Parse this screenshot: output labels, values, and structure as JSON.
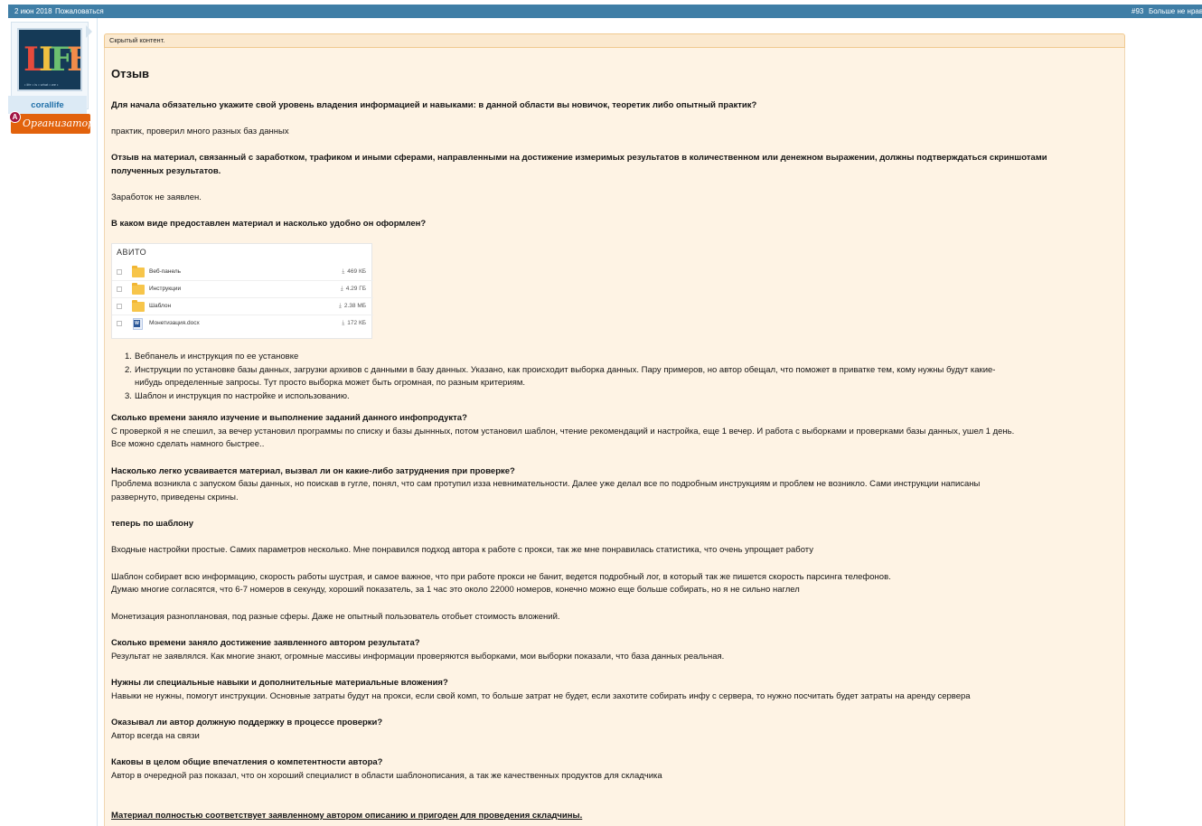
{
  "topbar": {
    "date": "2 июн 2018",
    "report": "Пожаловаться",
    "post_number": "#93",
    "dislike": "Больше не нравится"
  },
  "user": {
    "name": "corallife",
    "badge_letter": "A",
    "badge_label": "Организатор",
    "avatar_text": "LIFE",
    "avatar_tagline": "• life • is • what • we •"
  },
  "hidden_content_label": "Скрытый контент.",
  "review": {
    "heading": "Отзыв",
    "q1": "Для начала обязательно укажите свой уровень владения информацией и навыками: в данной области вы новичок, теоретик либо опытный практик?",
    "a1": "практик, проверил много разных баз данных",
    "q2_line1": "Отзыв на материал, связанный с заработком, трафиком и иными сферами, направленными на достижение измеримых результатов в количественном или денежном выражении, должны подтверждаться скриншотами",
    "q2_line2": "полученных результатов.",
    "a2": "Заработок не заявлен.",
    "q3": "В каком виде предоставлен материал и насколько удобно он оформлен?",
    "files_title": "АВИТО",
    "files": [
      {
        "name": "Веб-панель",
        "size": "469 КБ",
        "icon": "folder-icon"
      },
      {
        "name": "Инструкции",
        "size": "4.29 ГБ",
        "icon": "folder-icon"
      },
      {
        "name": "Шаблон",
        "size": "2.38 МБ",
        "icon": "folder-icon"
      },
      {
        "name": "Монетизация.docx",
        "size": "172 КБ",
        "icon": "word-document-icon"
      }
    ],
    "download_glyph": "⤓",
    "list": [
      {
        "n": "1.",
        "lines": [
          "Вебпанель и инструкция по ее установке"
        ]
      },
      {
        "n": "2.",
        "lines": [
          "Инструкции по установке базы данных, загрузки архивов с данными в базу данных. Указано, как происходит выборка данных. Пару примеров, но автор обещал, что поможет в приватке тем, кому нужны будут какие-",
          "нибудь определенные запросы. Тут просто выборка может быть огромная, по разным критериям."
        ]
      },
      {
        "n": "3.",
        "lines": [
          "Шаблон и инструкция по настройке и использованию."
        ]
      }
    ],
    "q4": "Сколько времени заняло изучение и выполнение заданий данного инфопродукта?",
    "a4_line1": "С проверкой я не спешил, за вечер установил программы по списку и базы дыннных, потом установил шаблон, чтение рекомендаций и настройка, еще 1 вечер. И работа с выборками и проверками базы данных, ушел 1 день.",
    "a4_line2": "Все можно сделать намного быстрее..",
    "q5": "Насколько легко усваивается материал, вызвал ли он какие-либо затруднения при проверке?",
    "a5_line1": "Проблема возникла с запуском базы данных, но поискав в гугле, понял, что сам протупил изза невнимательности. Далее уже делал все по подробным инструкциям и проблем не возникло. Сами инструкции написаны",
    "a5_line2": "развернуто, приведены скрины.",
    "sub_heading": "теперь по шаблону",
    "p1": "Входные настройки простые. Самих параметров несколько. Мне понравился подход автора к работе с прокси, так же мне понравилась статистика, что очень упрощает работу",
    "p2_line1": "Шаблон собирает всю информацию, скорость работы шустрая, и самое важное, что при работе прокси не банит, ведется подробный лог, в который так же пишется скорость парсинга телефонов.",
    "p2_line2": "Думаю многие согласятся, что 6-7 номеров в секунду, хороший показатель, за 1 час это около 22000 номеров, конечно можно еще больше собирать, но я не сильно наглел",
    "p3": "Монетизация разноплановая, под разные сферы. Даже не опытный пользователь отобьет стоимость вложений.",
    "q6": "Сколько времени заняло достижение заявленного автором результата?",
    "a6": "Результат не заявлялся. Как многие знают, огромные массивы информации проверяются выборками, мои выборки показали, что база данных реальная.",
    "q7": "Нужны ли специальные навыки и дополнительные материальные вложения?",
    "a7": "Навыки не нужны, помогут инструкции. Основные затраты будут на прокси, если свой комп, то больше затрат не будет, если захотите собирать инфу с сервера, то нужно посчитать будет затраты на аренду сервера",
    "q8": "Оказывал ли автор должную поддержку в процессе проверки?",
    "a8": "Автор всегда на связи",
    "q9": "Каковы в целом общие впечатления о компетентности автора?",
    "a9": "Автор в очередной раз показал, что он хороший специалист в области шаблонописания, а так же качественных продуктов для складчика",
    "conclusion": "Материал полностью соответствует заявленному автором описанию и пригоден для проведения складчины."
  },
  "colors": {
    "topbar": "#3f7ea6",
    "content_bg": "#fef3e4",
    "username": "#1f6fa8",
    "badge": "#e2620c"
  }
}
